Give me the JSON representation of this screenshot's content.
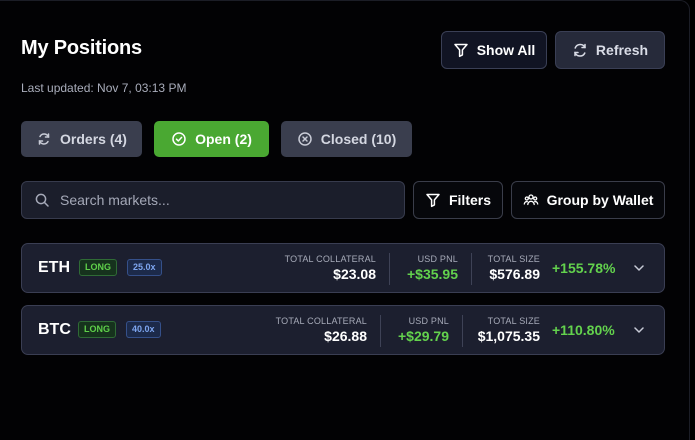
{
  "header": {
    "title": "My Positions",
    "last_updated": "Last updated: Nov 7, 03:13 PM",
    "show_all_label": "Show All",
    "refresh_label": "Refresh"
  },
  "tabs": [
    {
      "label": "Orders (4)",
      "icon": "refresh-icon",
      "active": false
    },
    {
      "label": "Open (2)",
      "icon": "check-circle-icon",
      "active": true
    },
    {
      "label": "Closed (10)",
      "icon": "x-circle-icon",
      "active": false
    }
  ],
  "search": {
    "placeholder": "Search markets..."
  },
  "toolbar": {
    "filters_label": "Filters",
    "group_label": "Group by Wallet"
  },
  "positions": [
    {
      "symbol": "ETH",
      "side": "LONG",
      "leverage": "25.0x",
      "collateral_label": "TOTAL COLLATERAL",
      "collateral": "$23.08",
      "pnl_label": "USD PNL",
      "pnl": "+$35.95",
      "size_label": "TOTAL SIZE",
      "size": "$576.89",
      "pnl_pct": "+155.78%"
    },
    {
      "symbol": "BTC",
      "side": "LONG",
      "leverage": "40.0x",
      "collateral_label": "TOTAL COLLATERAL",
      "collateral": "$26.88",
      "pnl_label": "USD PNL",
      "pnl": "+$29.79",
      "size_label": "TOTAL SIZE",
      "size": "$1,075.35",
      "pnl_pct": "+110.80%"
    }
  ],
  "colors": {
    "accent_green": "#4aa832",
    "profit_green": "#63d24d",
    "background": "#020204"
  }
}
